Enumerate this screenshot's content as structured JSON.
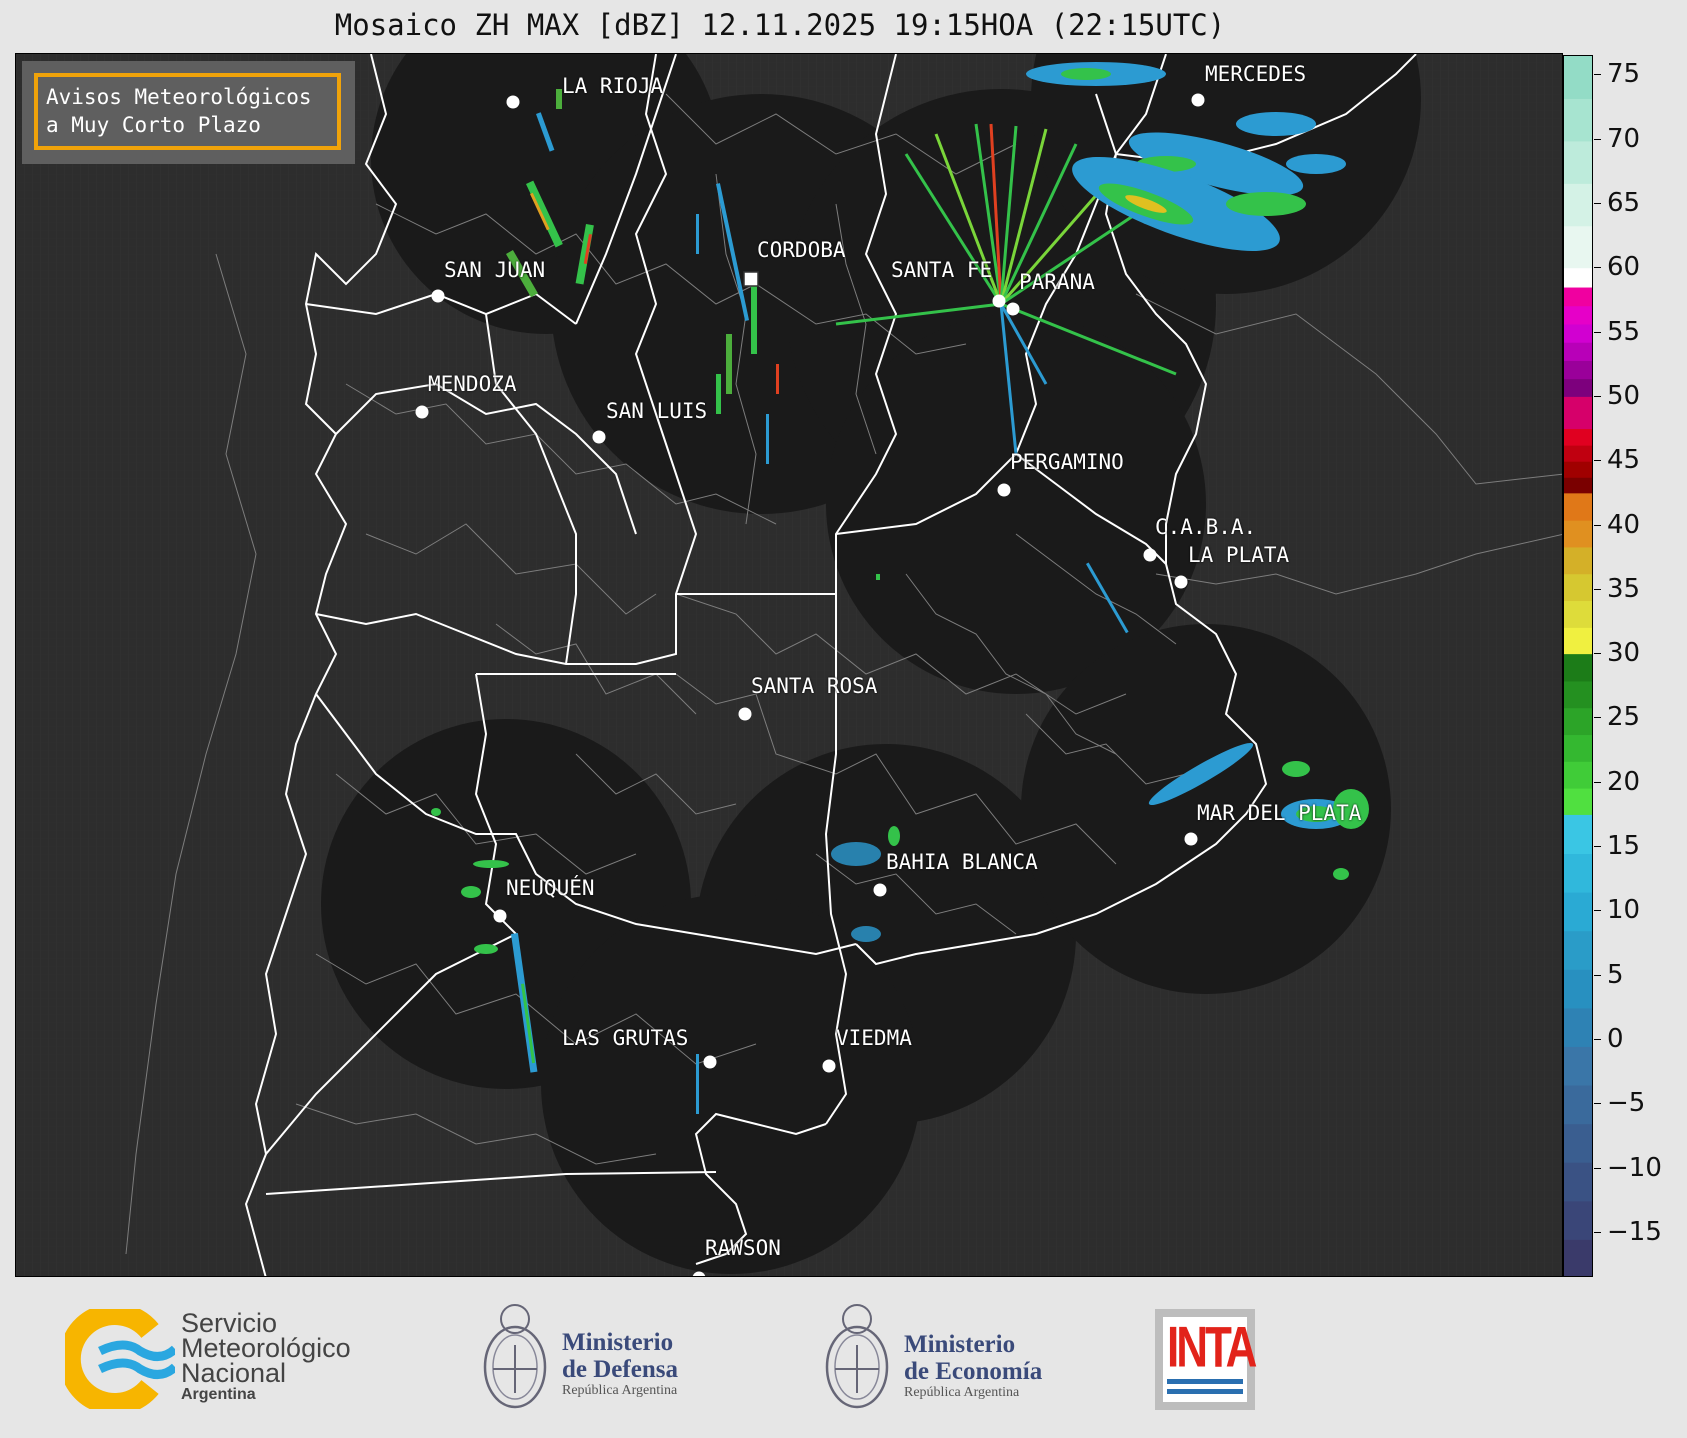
{
  "title": "Mosaico ZH MAX [dBZ] 12.11.2025 19:15HOA (22:15UTC)",
  "notice": {
    "line1": "Avisos Meteorológicos",
    "line2": "a Muy Corto Plazo"
  },
  "colors": {
    "map_background": "#2d2d2d",
    "radar_coverage": "#1a1a1a",
    "border_white": "#ffffff",
    "border_gray": "#8a8a8a",
    "notice_border": "#f0a30a"
  },
  "colorbar": {
    "min": -18.5,
    "max": 76.5,
    "ticks": [
      "75",
      "70",
      "65",
      "60",
      "55",
      "50",
      "45",
      "40",
      "35",
      "30",
      "25",
      "20",
      "15",
      "10",
      "5",
      "0",
      "−5",
      "−10",
      "−15"
    ],
    "tick_values": [
      75,
      70,
      65,
      60,
      55,
      50,
      45,
      40,
      35,
      30,
      25,
      20,
      15,
      10,
      5,
      0,
      -5,
      -10,
      -15
    ]
  },
  "cities": [
    {
      "name": "LA RIOJA",
      "marker": "dot"
    },
    {
      "name": "CORDOBA",
      "marker": "square"
    },
    {
      "name": "SAN JUAN",
      "marker": "dot"
    },
    {
      "name": "SANTA FE",
      "marker": "dot"
    },
    {
      "name": "PARANA",
      "marker": "dot"
    },
    {
      "name": "MERCEDES",
      "marker": "dot"
    },
    {
      "name": "MENDOZA",
      "marker": "dot"
    },
    {
      "name": "SAN LUIS",
      "marker": "dot"
    },
    {
      "name": "PERGAMINO",
      "marker": "dot"
    },
    {
      "name": "C.A.B.A.",
      "marker": "dot"
    },
    {
      "name": "LA PLATA",
      "marker": "dot"
    },
    {
      "name": "SANTA ROSA",
      "marker": "dot"
    },
    {
      "name": "MAR DEL PLATA",
      "marker": "dot"
    },
    {
      "name": "BAHIA BLANCA",
      "marker": "dot"
    },
    {
      "name": "NEUQUÉN",
      "marker": "dot"
    },
    {
      "name": "LAS GRUTAS",
      "marker": "dot"
    },
    {
      "name": "VIEDMA",
      "marker": "dot"
    },
    {
      "name": "RAWSON",
      "marker": "dot"
    }
  ],
  "footer": {
    "smn": {
      "line1": "Servicio",
      "line2": "Meteorológico",
      "line3": "Nacional",
      "sub": "Argentina"
    },
    "defensa": {
      "line1": "Ministerio",
      "line2": "de Defensa",
      "sub": "República Argentina"
    },
    "economia": {
      "line1": "Ministerio",
      "line2": "de Economía",
      "sub": "República Argentina"
    },
    "inta": {
      "text": "INTA"
    }
  }
}
